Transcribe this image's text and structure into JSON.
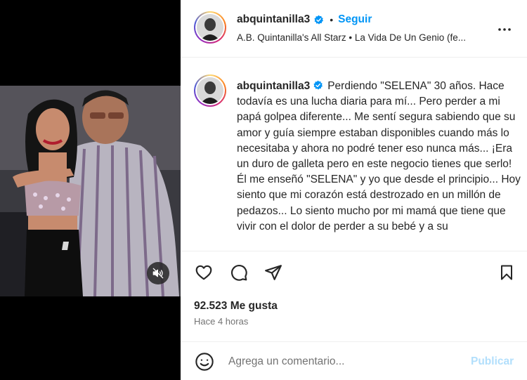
{
  "post": {
    "username": "abquintanilla3",
    "follow_label": "Seguir",
    "audio": "A.B. Quintanilla's All Starz • La Vida De Un Genio (fe...",
    "caption": "Perdiendo \"SELENA\" 30 años. Hace todavía es una lucha diaria para mí... Pero perder a mi papá golpea diferente... Me sentí segura sabiendo que su amor y guía siempre estaban disponibles cuando más lo necesitaba y ahora no podré tener eso nunca más... ¡Era un duro de galleta pero en este negocio tienes que serlo! Él me enseñó \"SELENA\" y yo que desde el principio... Hoy siento que mi corazón está destrozado en un millón de pedazos... Lo siento mucho por mi mamá que tiene que vivir con el dolor de perder a su bebé y a su",
    "likes": "92.523 Me gusta",
    "time": "Hace 4 horas"
  },
  "comment": {
    "placeholder": "Agrega un comentario...",
    "publish_label": "Publicar"
  },
  "icons": {
    "more": "more-options-icon",
    "like": "heart-icon",
    "comment": "comment-icon",
    "share": "send-icon",
    "save": "bookmark-icon",
    "emoji": "emoji-icon",
    "verified": "verified-badge-icon",
    "mute": "audio-muted-icon"
  },
  "colors": {
    "accent": "#0095f6",
    "publish_disabled": "#b2dffc",
    "verified": "#0095f6",
    "secondary_text": "#737373"
  }
}
